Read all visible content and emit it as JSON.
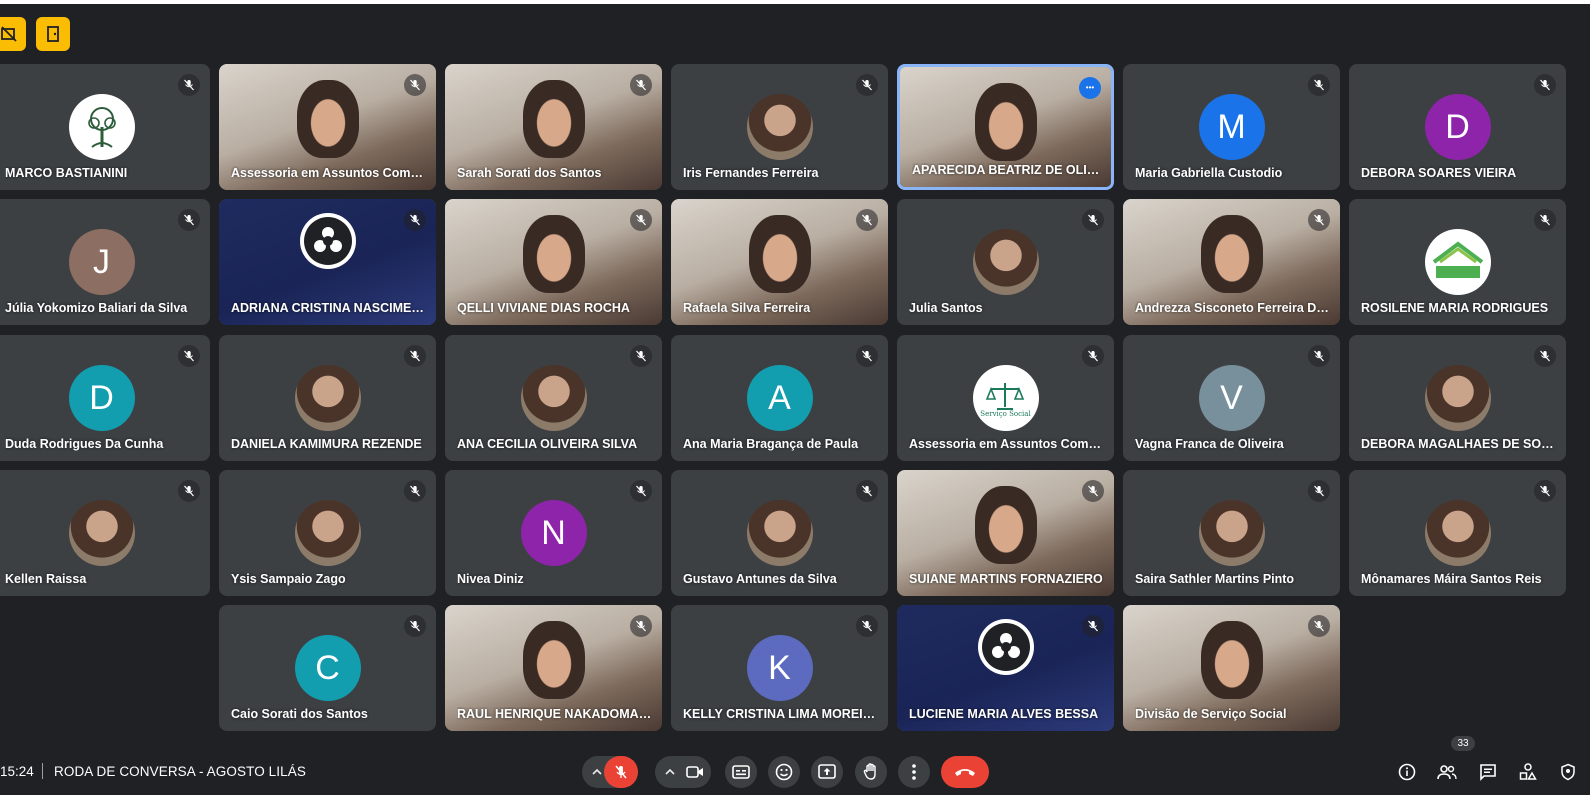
{
  "meeting": {
    "time": "15:24",
    "title": "RODA DE CONVERSA - AGOSTO LILÁS",
    "participants_count": "33"
  },
  "colors": {
    "background": "#202124",
    "tile": "#3c4043",
    "active_border": "#8ab4f8",
    "end_call": "#ea4335",
    "top_buttons": "#fbbc04"
  },
  "tiles": [
    {
      "name": "MARCO BASTIANINI",
      "icon": "tree-logo-avatar"
    },
    {
      "name": "Assessoria em Assuntos Comuni...",
      "icon": "camera-video"
    },
    {
      "name": "Sarah Sorati dos Santos",
      "icon": "camera-video"
    },
    {
      "name": "Iris Fernandes Ferreira",
      "icon": "photo-avatar"
    },
    {
      "name": "APARECIDA BEATRIZ DE OLIVEIRA",
      "icon": "camera-video",
      "active": true
    },
    {
      "name": "Maria Gabriella Custodio",
      "initial": "M",
      "color": "#1a73e8"
    },
    {
      "name": "DEBORA SOARES VIEIRA",
      "initial": "D",
      "color": "#8e24aa"
    },
    {
      "name": "Júlia Yokomizo Baliari da Silva",
      "initial": "J",
      "color": "#8d6e63"
    },
    {
      "name": "ADRIANA CRISTINA NASCIMENT...",
      "icon": "obs-logo-video"
    },
    {
      "name": "QELLI VIVIANE DIAS ROCHA",
      "icon": "camera-video"
    },
    {
      "name": "Rafaela Silva Ferreira",
      "icon": "camera-video"
    },
    {
      "name": "Julia Santos",
      "icon": "photo-avatar"
    },
    {
      "name": "Andrezza Sisconeto Ferreira Dias",
      "icon": "camera-video"
    },
    {
      "name": "ROSILENE MARIA RODRIGUES",
      "icon": "uftm-logo-avatar"
    },
    {
      "name": "Duda Rodrigues Da Cunha",
      "initial": "D",
      "color": "#129eaf"
    },
    {
      "name": "DANIELA KAMIMURA REZENDE",
      "icon": "photo-avatar"
    },
    {
      "name": "ANA CECILIA OLIVEIRA SILVA",
      "icon": "photo-avatar"
    },
    {
      "name": "Ana Maria Bragança de Paula",
      "initial": "A",
      "color": "#129eaf"
    },
    {
      "name": "Assessoria em Assuntos Comuni...",
      "icon": "servico-social-logo-avatar",
      "logo_text": "Serviço Social"
    },
    {
      "name": "Vagna Franca de Oliveira",
      "initial": "V",
      "color": "#78909c"
    },
    {
      "name": "DEBORA MAGALHAES DE SOUZ...",
      "icon": "photo-avatar"
    },
    {
      "name": "Kellen Raissa",
      "icon": "photo-avatar"
    },
    {
      "name": "Ysis Sampaio Zago",
      "icon": "photo-avatar"
    },
    {
      "name": "Nivea Diniz",
      "initial": "N",
      "color": "#8e24aa"
    },
    {
      "name": "Gustavo Antunes da Silva",
      "icon": "photo-avatar"
    },
    {
      "name": "SUIANE MARTINS FORNAZIERO",
      "icon": "camera-video"
    },
    {
      "name": "Saira Sathler Martins Pinto",
      "icon": "photo-avatar"
    },
    {
      "name": "Mônamares Máira Santos Reis",
      "icon": "photo-avatar"
    },
    {
      "name": "Caio Sorati dos Santos",
      "initial": "C",
      "color": "#129eaf"
    },
    {
      "name": "RAUL HENRIQUE NAKADOMARI ...",
      "icon": "camera-video"
    },
    {
      "name": "KELLY CRISTINA LIMA MOREIRA",
      "initial": "K",
      "color": "#5c6bc0"
    },
    {
      "name": "LUCIENE MARIA ALVES BESSA",
      "icon": "obs-logo-video"
    },
    {
      "name": "Divisão de Serviço Social",
      "icon": "camera-video"
    }
  ],
  "controls": {
    "mic": "mic-off-icon",
    "camera": "camera-icon",
    "captions": "captions-icon",
    "emoji": "emoji-icon",
    "present": "present-screen-icon",
    "hand": "raise-hand-icon",
    "more": "more-options-icon",
    "end": "end-call-icon",
    "info": "info-icon",
    "people": "people-icon",
    "chat": "chat-icon",
    "activities": "activities-icon",
    "host": "host-controls-icon"
  }
}
